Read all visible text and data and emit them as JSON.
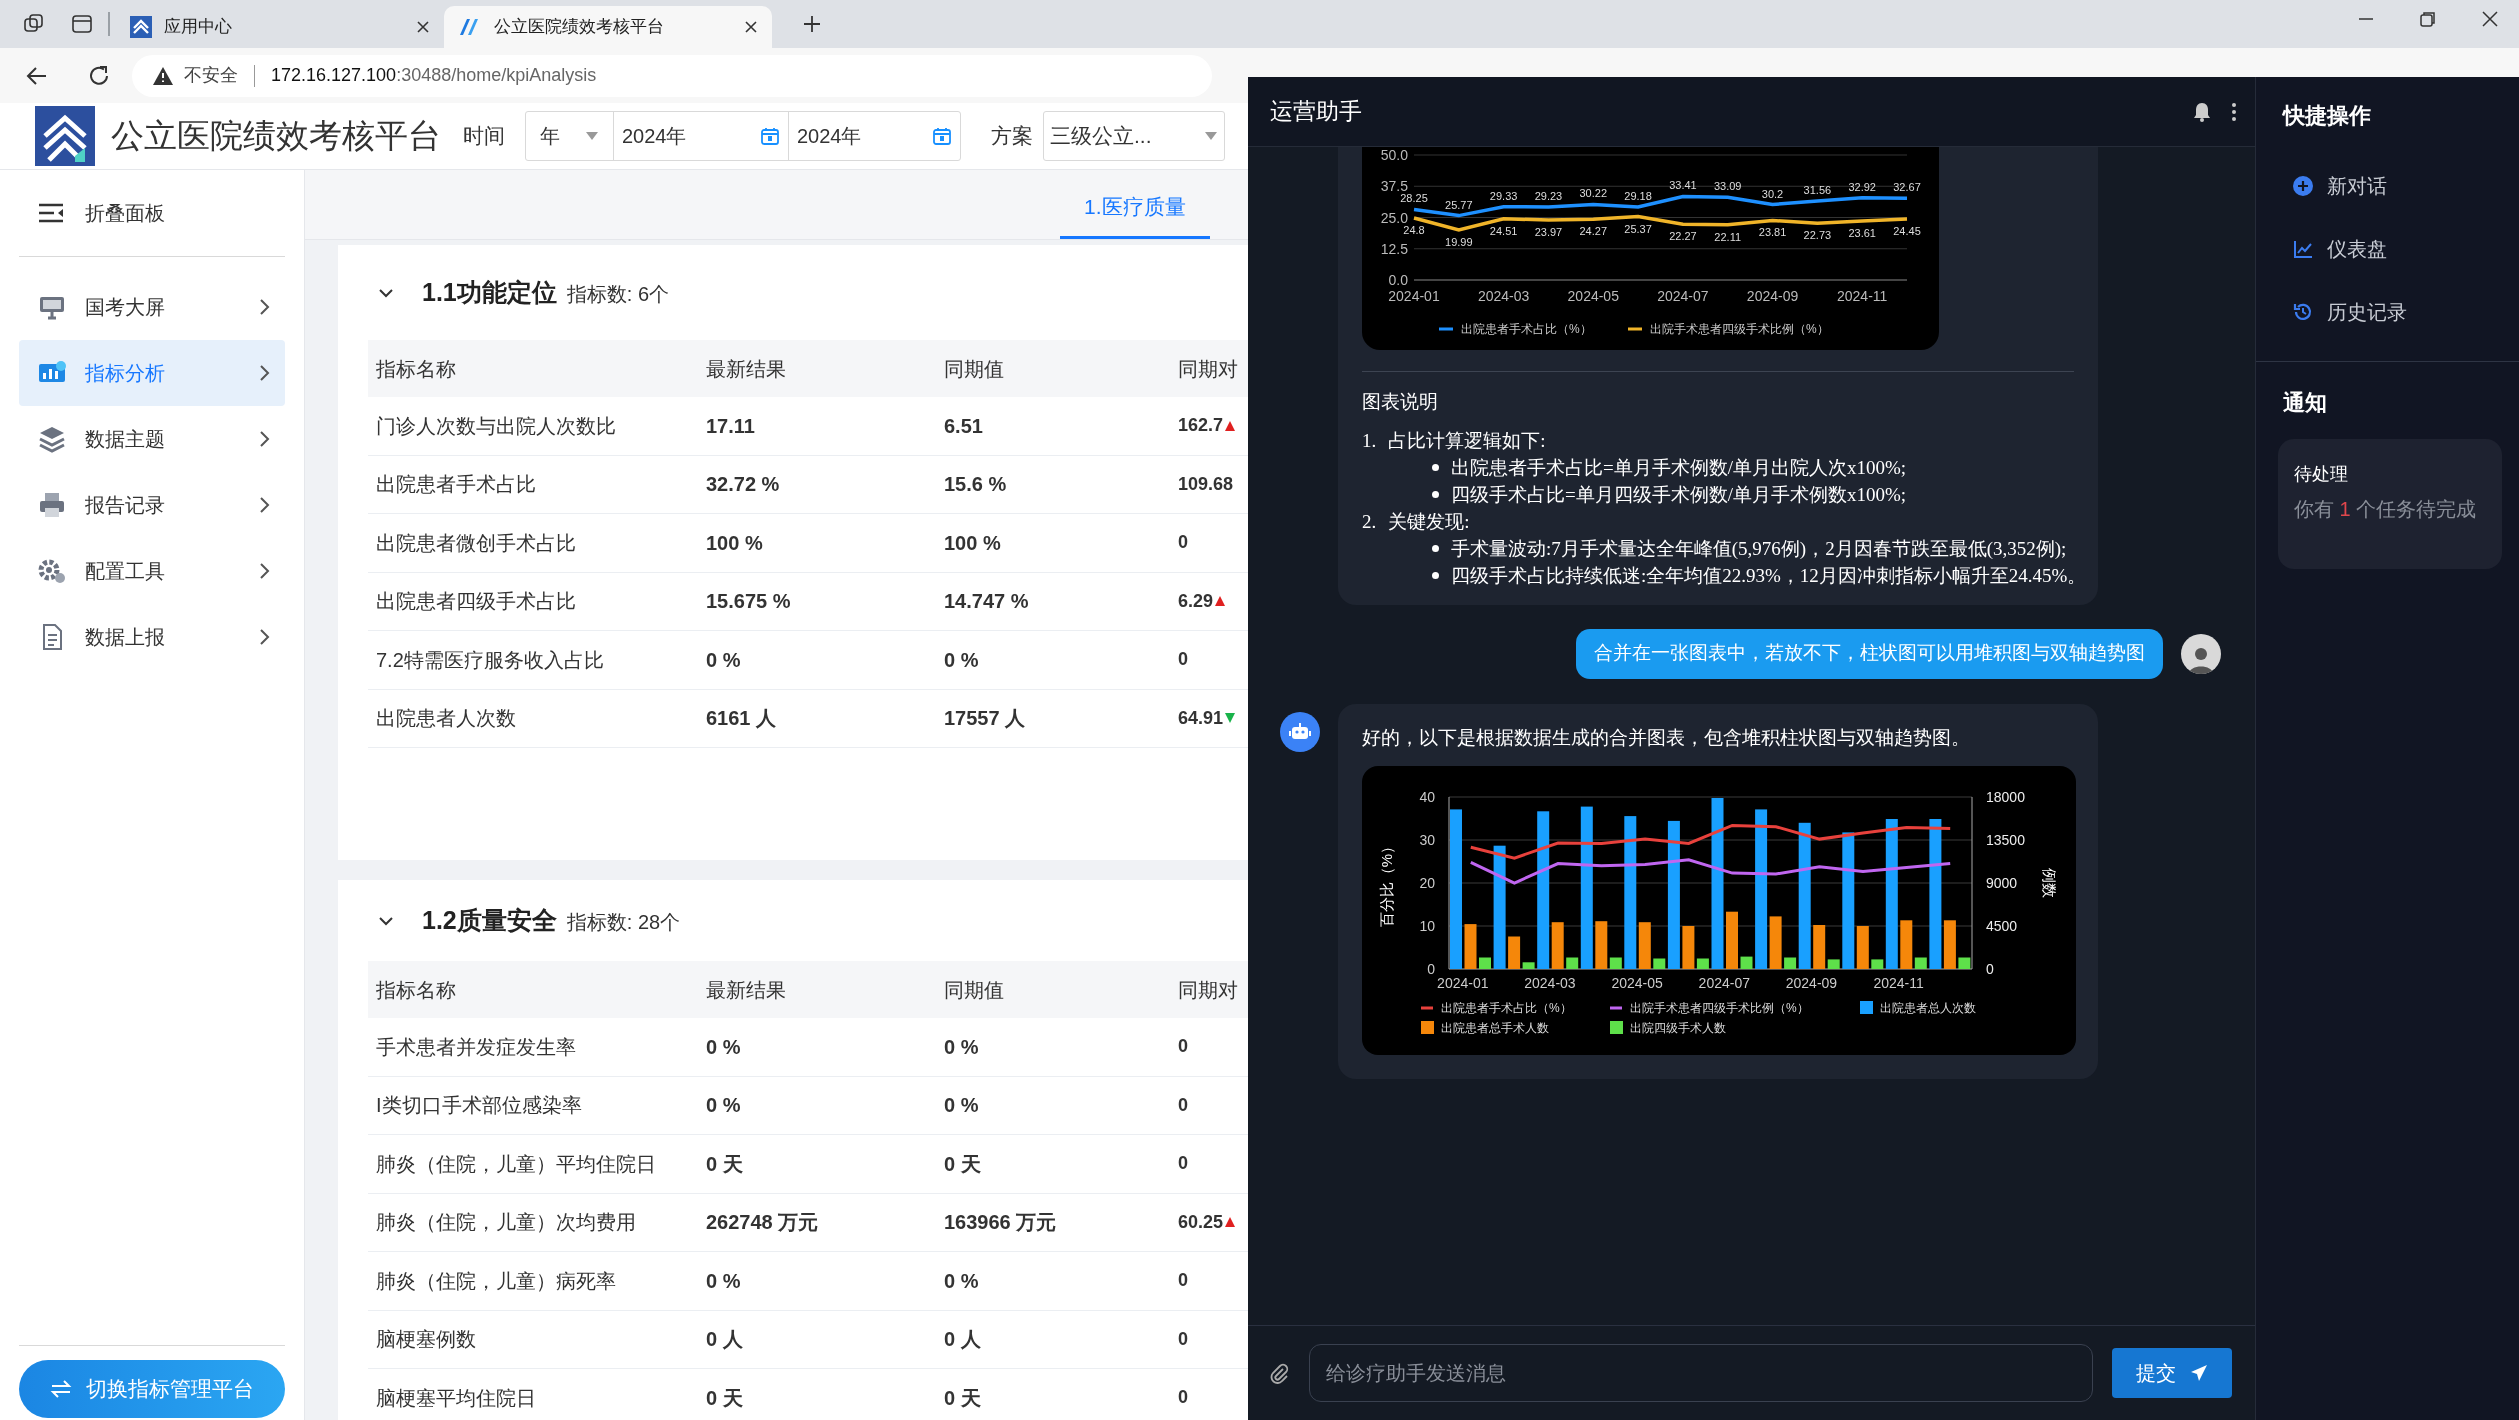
{
  "browser": {
    "tabs": [
      {
        "title": "应用中心",
        "selected": false
      },
      {
        "title": "公立医院绩效考核平台",
        "selected": true
      }
    ],
    "address": {
      "security": "不安全",
      "host": "172.16.127.100",
      "path": ":30488/home/kpiAnalysis"
    }
  },
  "app": {
    "title": "公立医院绩效考核平台",
    "filters": {
      "time_label": "时间",
      "period": "年",
      "start": "2024年",
      "end": "2024年",
      "plan_label": "方案",
      "plan": "三级公立..."
    }
  },
  "sidebar": {
    "collapse": "折叠面板",
    "items": [
      {
        "label": "国考大屏",
        "selected": false
      },
      {
        "label": "指标分析",
        "selected": true
      },
      {
        "label": "数据主题",
        "selected": false
      },
      {
        "label": "报告记录",
        "selected": false
      },
      {
        "label": "配置工具",
        "selected": false
      },
      {
        "label": "数据上报",
        "selected": false
      }
    ],
    "switch_button": "切换指标管理平台"
  },
  "content_tabs": [
    {
      "label": "1.医疗质量",
      "selected": true
    }
  ],
  "sections": [
    {
      "title": "1.1功能定位",
      "count": "指标数: 6个",
      "expanded": true,
      "columns": [
        "指标名称",
        "最新结果",
        "同期值",
        "同期对"
      ],
      "rows": [
        {
          "name": "门诊人次数与出院人次数比",
          "latest": "17.11",
          "previous": "6.51",
          "change": "162.7",
          "kind": "rise"
        },
        {
          "name": "出院患者手术占比",
          "latest": "32.72 %",
          "previous": "15.6 %",
          "change": "109.68",
          "kind": "plain"
        },
        {
          "name": "出院患者微创手术占比",
          "latest": "100 %",
          "previous": "100 %",
          "change": "0",
          "kind": "plain"
        },
        {
          "name": "出院患者四级手术占比",
          "latest": "15.675 %",
          "previous": "14.747 %",
          "change": "6.29",
          "kind": "rise"
        },
        {
          "name": "7.2特需医疗服务收入占比",
          "latest": "0 %",
          "previous": "0 %",
          "change": "0",
          "kind": "plain"
        },
        {
          "name": "出院患者人次数",
          "latest": "6161 人",
          "previous": "17557 人",
          "change": "64.91",
          "kind": "fall"
        }
      ]
    },
    {
      "title": "1.2质量安全",
      "count": "指标数: 28个",
      "expanded": true,
      "columns": [
        "指标名称",
        "最新结果",
        "同期值",
        "同期对"
      ],
      "rows": [
        {
          "name": "手术患者并发症发生率",
          "latest": "0 %",
          "previous": "0 %",
          "change": "0",
          "kind": "plain"
        },
        {
          "name": "I类切口手术部位感染率",
          "latest": "0 %",
          "previous": "0 %",
          "change": "0",
          "kind": "plain"
        },
        {
          "name": "肺炎（住院，儿童）平均住院日",
          "latest": "0 天",
          "previous": "0 天",
          "change": "0",
          "kind": "plain"
        },
        {
          "name": "肺炎（住院，儿童）次均费用",
          "latest": "262748 万元",
          "previous": "163966 万元",
          "change": "60.25",
          "kind": "rise"
        },
        {
          "name": "肺炎（住院，儿童）病死率",
          "latest": "0 %",
          "previous": "0 %",
          "change": "0",
          "kind": "plain"
        },
        {
          "name": "脑梗塞例数",
          "latest": "0 人",
          "previous": "0 人",
          "change": "0",
          "kind": "plain"
        },
        {
          "name": "脑梗塞平均住院日",
          "latest": "0 天",
          "previous": "0 天",
          "change": "0",
          "kind": "plain"
        }
      ]
    }
  ],
  "assistant": {
    "title": "运营助手",
    "messages": [
      {
        "kind": "assistant",
        "chart_data": {
          "type": "line",
          "categories": [
            "2024-01",
            null,
            "2024-03",
            null,
            "2024-05",
            null,
            "2024-07",
            null,
            "2024-09",
            null,
            "2024-11",
            null
          ],
          "ylim": [
            0,
            50
          ],
          "grid": true,
          "legend": true,
          "yticks": [
            {
              "value": 0,
              "label": "0.0"
            },
            {
              "value": 12.5,
              "label": "12.5"
            },
            {
              "value": 25,
              "label": "25.0"
            },
            {
              "value": 37.5,
              "label": "37.5"
            },
            {
              "value": 50,
              "label": "50.0"
            }
          ],
          "data_labels": true,
          "series": [
            {
              "name": "出院患者手术占比（%）",
              "color": "#1e90ff",
              "values": [
                28.25,
                25.77,
                29.33,
                29.23,
                30.22,
                29.18,
                33.41,
                33.09,
                30.2,
                31.56,
                32.92,
                32.67
              ]
            },
            {
              "name": "出院手术患者四级手术比例（%）",
              "color": "#f0b429",
              "values": [
                24.8,
                19.99,
                24.51,
                23.97,
                24.27,
                25.37,
                22.27,
                22.11,
                23.81,
                22.73,
                23.61,
                24.45
              ]
            }
          ]
        },
        "caption_title": "图表说明",
        "notes": [
          {
            "number": "1.",
            "text": "占比计算逻辑如下:",
            "bullets": [
              "出院患者手术占比=单月手术例数/单月出院人次x100%;",
              "四级手术占比=单月四级手术例数/单月手术例数x100%;"
            ]
          },
          {
            "number": "2.",
            "text": "关键发现:",
            "bullets": [
              "手术量波动:7月手术量达全年峰值(5,976例)，2月因春节跌至最低(3,352例);",
              "四级手术占比持续低迷:全年均值22.93%，12月因冲刺指标小幅升至24.45%。"
            ]
          }
        ]
      },
      {
        "kind": "user",
        "text": "合并在一张图表中，若放不下，柱状图可以用堆积图与双轴趋势图"
      },
      {
        "kind": "assistant",
        "text": "好的，以下是根据数据生成的合并图表，包含堆积柱状图与双轴趋势图。",
        "chart_data": {
          "type": "bar",
          "categories": [
            "2024-01",
            null,
            "2024-03",
            null,
            "2024-05",
            null,
            "2024-07",
            null,
            "2024-09",
            null,
            "2024-11",
            null
          ],
          "grid": true,
          "legend": true,
          "ylabel": "百分比（%）",
          "y2label": "例数",
          "ylim": [
            0,
            40
          ],
          "y2lim": [
            0,
            18000
          ],
          "yticks": [
            0,
            10,
            20,
            30,
            40
          ],
          "y2ticks": [
            0,
            4500,
            9000,
            13500,
            18000
          ],
          "series": [
            {
              "name": "出院患者手术占比（%）",
              "type": "line",
              "color": "#e8413c",
              "values": [
                28.3,
                25.8,
                29.3,
                29.2,
                30.2,
                29.2,
                33.4,
                33.1,
                30.2,
                31.6,
                32.9,
                32.7
              ]
            },
            {
              "name": "出院手术患者四级手术比例（%）",
              "type": "line",
              "color": "#c066f0",
              "values": [
                24.8,
                20,
                24.5,
                24,
                24.3,
                25.4,
                22.3,
                22.1,
                23.8,
                22.7,
                23.6,
                24.5
              ]
            },
            {
              "name": "出院患者总人次数",
              "type": "bar",
              "axis": "y2",
              "color": "#19a0ff",
              "values": [
                16700,
                12900,
                16500,
                17000,
                16000,
                15500,
                17900,
                16700,
                15300,
                14300,
                15700,
                15700
              ]
            },
            {
              "name": "出院患者总手术人数",
              "type": "bar",
              "axis": "y2",
              "color": "#f5870a",
              "values": [
                4700,
                3400,
                4900,
                5000,
                4900,
                4500,
                6000,
                5500,
                4600,
                4500,
                5100,
                5100
              ]
            },
            {
              "name": "出院四级手术人数",
              "type": "bar",
              "axis": "y2",
              "color": "#5ee04a",
              "values": [
                1200,
                700,
                1200,
                1200,
                1100,
                1100,
                1300,
                1200,
                1000,
                1000,
                1200,
                1200
              ]
            }
          ]
        }
      }
    ],
    "input": {
      "placeholder": "给诊疗助手发送消息",
      "submit": "提交"
    }
  },
  "quick_actions": {
    "title": "快捷操作",
    "items": [
      "新对话",
      "仪表盘",
      "历史记录"
    ]
  },
  "notifications": {
    "title": "通知",
    "items": [
      {
        "title": "待处理",
        "prefix": "你有",
        "count": "1",
        "suffix": "个任务待完成"
      }
    ]
  }
}
